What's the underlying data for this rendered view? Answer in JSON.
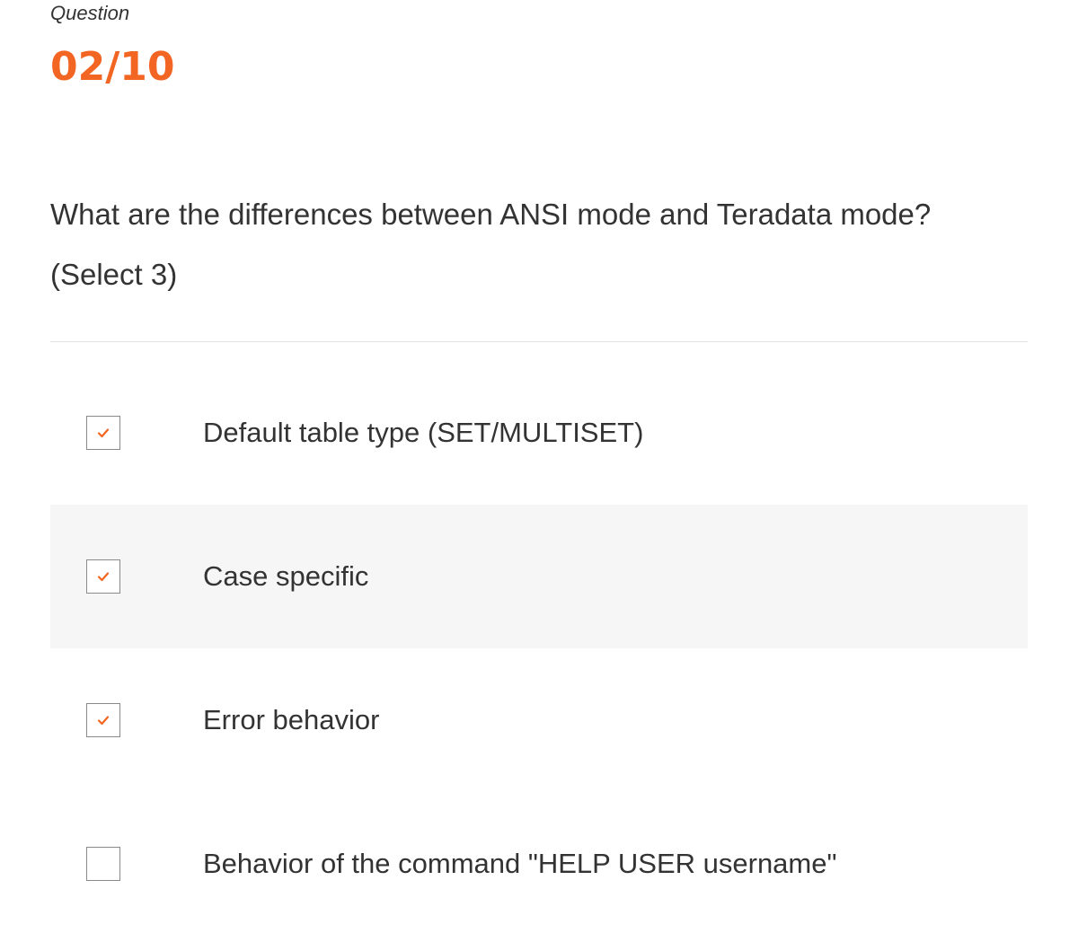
{
  "header": {
    "question_label": "Question",
    "question_number": "02/10"
  },
  "question": {
    "text": "What are the differences between ANSI mode and Teradata mode?",
    "hint": "(Select 3)"
  },
  "options": [
    {
      "label": "Default table type (SET/MULTISET)",
      "checked": true
    },
    {
      "label": "Case specific",
      "checked": true
    },
    {
      "label": "Error behavior",
      "checked": true
    },
    {
      "label": "Behavior of the command \"HELP USER username\"",
      "checked": false
    }
  ],
  "colors": {
    "accent": "#f26522",
    "text": "#333333",
    "highlight_row": "#f6f6f6",
    "divider": "#e2e2e2"
  },
  "icons": {
    "check": "checkmark-icon"
  }
}
